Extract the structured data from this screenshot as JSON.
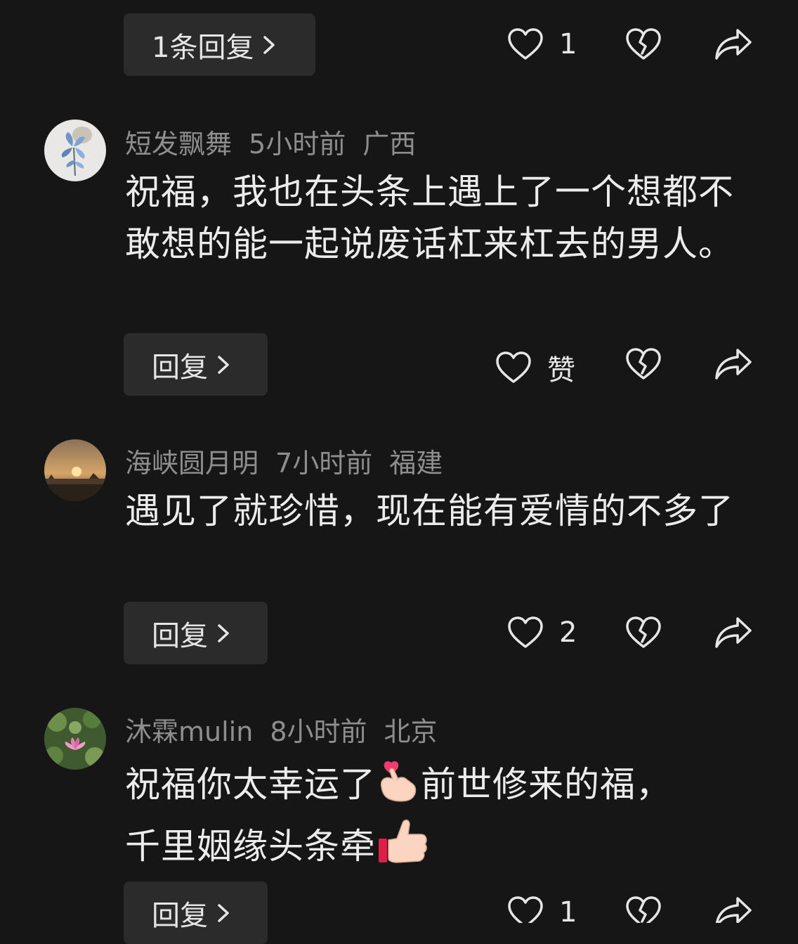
{
  "top_item": {
    "reply_label": "1条回复",
    "like_count": "1"
  },
  "comments": [
    {
      "username": "短发飘舞",
      "time": "5小时前",
      "location": "广西",
      "text": "祝福，我也在头条上遇上了一个想都不敢想的能一起说废话杠来杠去的男人。",
      "reply_label": "回复",
      "like_label": "赞"
    },
    {
      "username": "海峡圆月明",
      "time": "7小时前",
      "location": "福建",
      "text": "遇见了就珍惜，现在能有爱情的不多了",
      "reply_label": "回复",
      "like_label": "2"
    },
    {
      "username": "沐霖mulin",
      "time": "8小时前",
      "location": "北京",
      "text_parts": [
        "祝福你太幸运了",
        "前世修来的福，",
        "千里姻缘头条牵"
      ],
      "emojis": [
        "finger-heart-emoji",
        "thumbs-up-emoji"
      ],
      "reply_label": "回复",
      "like_label": "1"
    }
  ],
  "icons": {
    "like": "heart-outline-icon",
    "dislike": "broken-heart-icon",
    "share": "share-arrow-icon",
    "more": "chevron-right-icon"
  },
  "colors": {
    "background": "#161616",
    "button_bg": "#2b2b2b",
    "meta_text": "#8e8e8e",
    "main_text": "#ececec"
  }
}
